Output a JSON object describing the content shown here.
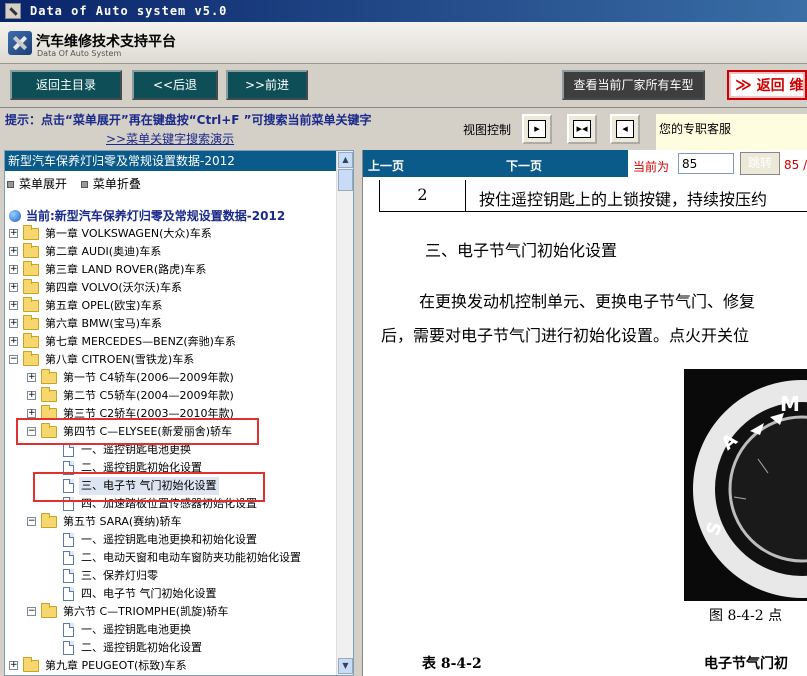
{
  "window": {
    "title": "Data of Auto system v5.0"
  },
  "brand": {
    "title": "汽车维修技术支持平台",
    "subtitle": "Data Of Auto System"
  },
  "toolbar": {
    "home": "返回主目录",
    "back": "<<后退",
    "forward": ">>前进",
    "all_models": "查看当前厂家所有车型",
    "return": "返回 维"
  },
  "hint": {
    "text": "提示：点击“菜单展开”再在键盘按“Ctrl+F ”可搜索当前菜单关键字",
    "link": ">>菜单关键字搜索演示",
    "view_control": "视图控制",
    "service": "您的专职客服"
  },
  "left": {
    "header": "新型汽车保养灯归零及常规设置数据-2012",
    "expand": "菜单展开",
    "collapse": "菜单折叠",
    "tree": [
      {
        "text": "当前:新型汽车保养灯归零及常规设置数据-2012",
        "kind": "current"
      },
      {
        "text": "第一章  VOLKSWAGEN(大众)车系",
        "kind": "folder"
      },
      {
        "text": "第二章  AUDI(奥迪)车系",
        "kind": "folder"
      },
      {
        "text": "第三章  LAND ROVER(路虎)车系",
        "kind": "folder"
      },
      {
        "text": "第四章  VOLVO(沃尔沃)车系",
        "kind": "folder"
      },
      {
        "text": "第五章  OPEL(欧宝)车系",
        "kind": "folder"
      },
      {
        "text": "第六章  BMW(宝马)车系",
        "kind": "folder"
      },
      {
        "text": "第七章  MERCEDES—BENZ(奔驰)车系",
        "kind": "folder"
      },
      {
        "text": "第八章  CITROEN(雪铁龙)车系",
        "kind": "folder-open"
      },
      {
        "text": "第一节  C4轿车(2006—2009年款)",
        "kind": "folder"
      },
      {
        "text": "第二节  C5轿车(2004—2009年款)",
        "kind": "folder"
      },
      {
        "text": "第三节  C2轿车(2003—2010年款)",
        "kind": "folder"
      },
      {
        "text": "第四节  C—ELYSEE(新爱丽舍)轿车",
        "kind": "folder-open"
      },
      {
        "text": "一、遥控钥匙电池更换",
        "kind": "doc"
      },
      {
        "text": "二、遥控钥匙初始化设置",
        "kind": "doc"
      },
      {
        "text": "三、电子节  气门初始化设置",
        "kind": "doc-selected"
      },
      {
        "text": "四、加速踏板位置传感器初始化设置",
        "kind": "doc"
      },
      {
        "text": "第五节  SARA(赛纳)轿车",
        "kind": "folder-open"
      },
      {
        "text": "一、遥控钥匙电池更换和初始化设置",
        "kind": "doc"
      },
      {
        "text": "二、电动天窗和电动车窗防夹功能初始化设置",
        "kind": "doc"
      },
      {
        "text": "三、保养灯归零",
        "kind": "doc"
      },
      {
        "text": "四、电子节  气门初始化设置",
        "kind": "doc"
      },
      {
        "text": "第六节  C—TRIOMPHE(凯旋)轿车",
        "kind": "folder-open"
      },
      {
        "text": "一、遥控钥匙电池更换",
        "kind": "doc"
      },
      {
        "text": "二、遥控钥匙初始化设置",
        "kind": "doc"
      },
      {
        "text": "第九章  PEUGEOT(标致)车系",
        "kind": "folder"
      }
    ]
  },
  "right": {
    "prev": "上一页",
    "next": "下一页",
    "current_label": "当前为",
    "page_value": "85",
    "jump": "跳转",
    "total": "85 /",
    "row_num": "2",
    "row_text": "按住遥控钥匙上的上锁按键，持续按压约",
    "heading": "三、电子节气门初始化设置",
    "para1": "在更换发动机控制单元、更换电子节气门、修复",
    "para2": "后，需要对电子节气门进行初始化设置。点火开关位",
    "caption": "图 8-4-2   点",
    "bottom_left": "表 8-4-2",
    "bottom_right": "电子节气门初"
  }
}
